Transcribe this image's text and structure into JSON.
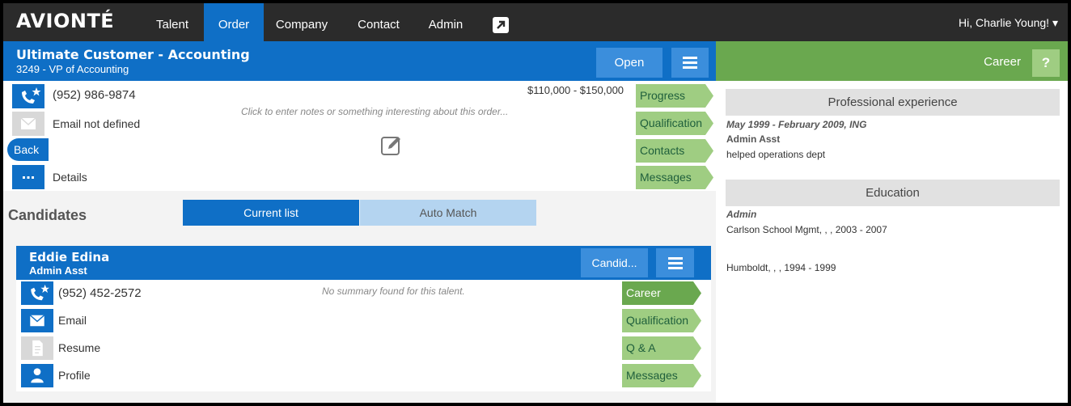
{
  "nav": {
    "logo": "AVIONTÉ",
    "items": [
      {
        "label": "Talent",
        "active": false
      },
      {
        "label": "Order",
        "active": true
      },
      {
        "label": "Company",
        "active": false
      },
      {
        "label": "Contact",
        "active": false
      },
      {
        "label": "Admin",
        "active": false
      }
    ],
    "user_greeting": "Hi, Charlie Young!",
    "user_caret": "▾"
  },
  "order": {
    "title": "Ultimate Customer - Accounting",
    "subtitle": "3249 - VP of Accounting",
    "open_label": "Open",
    "phone": "(952) 986-9874",
    "email": "Email not defined",
    "back_label": "Back",
    "details_label": "Details",
    "salary": "$110,000 - $150,000",
    "notes_placeholder": "Click to enter notes or something interesting about this order...",
    "tabs": [
      "Progress",
      "Qualification",
      "Contacts",
      "Messages"
    ]
  },
  "candidates": {
    "title": "Candidates",
    "current_list_label": "Current list",
    "auto_match_label": "Auto Match",
    "candidate": {
      "name": "Eddie Edina",
      "role": "Admin Asst",
      "candid_label": "Candid...",
      "phone": "(952) 452-2572",
      "email_label": "Email",
      "resume_label": "Resume",
      "profile_label": "Profile",
      "summary": "No summary found for this talent.",
      "tabs": [
        "Career",
        "Qualification",
        "Q & A",
        "Messages"
      ]
    }
  },
  "career": {
    "header_label": "Career",
    "help_label": "?",
    "experience_title": "Professional experience",
    "experience": {
      "period": "May 1999 - February 2009, ING",
      "title": "Admin Asst",
      "description": "helped operations dept"
    },
    "education_title": "Education",
    "education": [
      {
        "degree": "Admin",
        "school": "Carlson School Mgmt, , , 2003 - 2007"
      },
      {
        "degree": "",
        "school": "Humboldt, , , 1994 - 1999"
      }
    ]
  },
  "colors": {
    "nav_bg": "#2b2b2b",
    "primary_blue": "#0f6fc6",
    "light_blue": "#3b8edc",
    "career_green": "#6aa84f",
    "tab_green": "#9fcd82"
  }
}
